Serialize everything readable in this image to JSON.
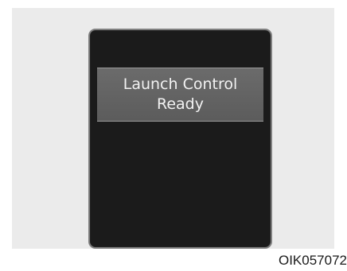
{
  "message": {
    "line1": "Launch Control",
    "line2": "Ready"
  },
  "figure_code": "OIK057072",
  "colors": {
    "background": "#ffffff",
    "panel": "#ebebeb",
    "display": "#1b1b1b",
    "display_border": "#7f7f7f",
    "banner": "#666666",
    "banner_text": "#f2f2f2"
  }
}
